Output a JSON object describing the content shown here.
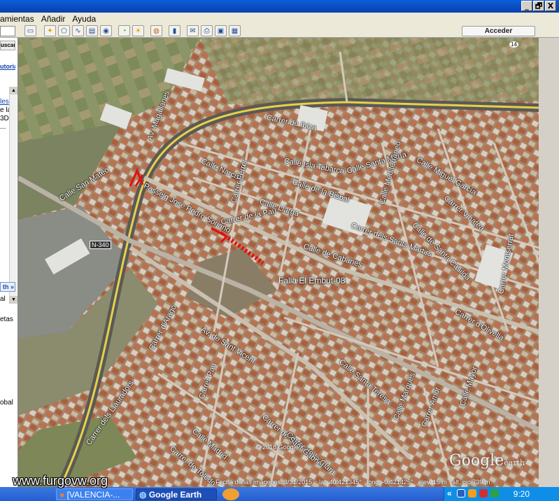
{
  "menu": {
    "items": [
      "amientas",
      "Añadir",
      "Ayuda"
    ]
  },
  "window_buttons": [
    "_",
    "🗗",
    "X"
  ],
  "toolbar": {
    "acceder_label": "Acceder",
    "icons": [
      "sidebar-toggle-icon",
      "placemark-icon",
      "polygon-icon",
      "path-icon",
      "image-overlay-icon",
      "record-tour-icon",
      "historical-imagery-icon",
      "sun-icon",
      "planets-icon",
      "ruler-icon",
      "email-icon",
      "print-icon",
      "save-image-icon",
      "maps-icon"
    ]
  },
  "left_panel": {
    "buscar_label": "uscar",
    "tutorial_label": "utorial",
    "text_lines": [
      "les",
      "e la",
      "3D",
      "..."
    ],
    "earth_tab": "th »",
    "lower_lines": [
      "al",
      "etas",
      "obal"
    ]
  },
  "map": {
    "place_label": "Falla El Embut-08",
    "road_badge": "N-340",
    "road_badge_2": "14",
    "street_labels": [
      "Av. Magallanes",
      "Calle Narciso",
      "Carrer de Ibiza",
      "Carrer Ferrer",
      "Calle Llarga",
      "Calle Santa María",
      "Calle de Cabanes",
      "Carrer dels Sants Màrtirs",
      "Passeig Jose Pedro Soriano",
      "Calle Marqués",
      "Av. de Sant Vicent",
      "Carrer d'Aragó",
      "Carrer Pau",
      "Calle Madrid",
      "Carrer de Toledo",
      "Carrer dels Llauradors",
      "Carrer de la Pau",
      "Calle San Mateo",
      "Calle Santa Teresa",
      "Carrer de la Clara",
      "Carrer de Sant Gabriel",
      "Calle Miguel García",
      "Carrer Vinatea",
      "Carrer d'Olivella",
      "Calle de Santa Casilda",
      "Carrer Amor",
      "Calle Mayor",
      "Carrer Montserrat",
      "Calle de la Bisbal",
      "Calle Mediterráneo",
      "Calle Isla Tabarca"
    ],
    "copyright": "© 2018 Google",
    "logo_main": "Google",
    "logo_sub": "earth",
    "status": {
      "date": "Fecha de las imágenes: 3/31/2015",
      "lat": "lat.  40.421345°",
      "lon": "long.  -0.421425°",
      "elev": "elev.   15 m",
      "alt": "alt. ojo   739 m"
    }
  },
  "watermark": "www.furgovw.org",
  "taskbar": {
    "task1": "[VALENCIA-...",
    "task2": "Google Earth",
    "tray_chevron": "«",
    "clock": "9:20"
  },
  "colors": {
    "route_marker": "#e01010",
    "title_bar": "#0a3fb0",
    "road_yellow": "#e8d04a"
  }
}
